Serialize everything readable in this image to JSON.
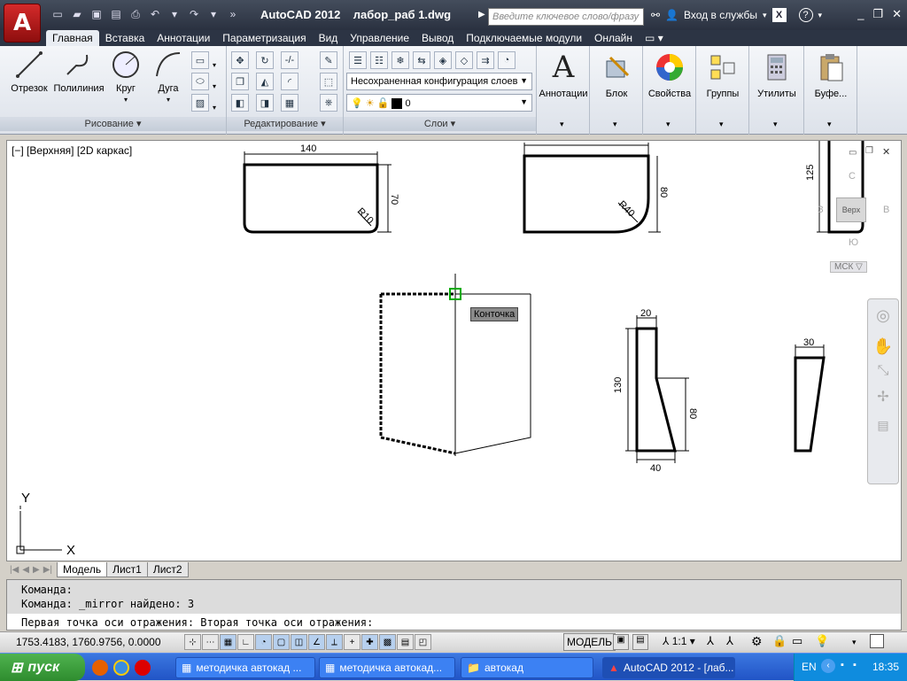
{
  "titlebar": {
    "app_name": "AutoCAD 2012",
    "file_name": "лабор_раб 1.dwg",
    "search_placeholder": "Введите ключевое слово/фразу",
    "login_label": "Вход в службы",
    "app_logo": "A"
  },
  "ribbon_tabs": [
    "Главная",
    "Вставка",
    "Аннотации",
    "Параметризация",
    "Вид",
    "Управление",
    "Вывод",
    "Подключаемые модули",
    "Онлайн"
  ],
  "ribbon": {
    "draw_tools": [
      "Отрезок",
      "Полилиния",
      "Круг",
      "Дуга"
    ],
    "draw_panel": "Рисование",
    "modify_panel": "Редактирование",
    "layer_config": "Несохраненная конфигурация слоев",
    "current_layer": "0",
    "layers_panel": "Слои",
    "right_tools": [
      "Аннотации",
      "Блок",
      "Свойства",
      "Группы",
      "Утилиты",
      "Буфе..."
    ],
    "annotation_glyph": "A"
  },
  "viewport": {
    "label": "[−] [Верхняя] [2D каркас]",
    "tooltip": "Конточка",
    "ucs_x": "X",
    "ucs_y": "Y",
    "viewcube": {
      "top": "Верх",
      "north": "С",
      "south": "Ю",
      "west": "З",
      "east": "В",
      "wcs": "МСК"
    },
    "dims": {
      "d140": "140",
      "d70": "70",
      "r10": "R10",
      "d80a": "80",
      "r40": "R40",
      "d125": "125",
      "d20": "20",
      "d130": "130",
      "d80b": "80",
      "d40": "40",
      "d30": "30"
    }
  },
  "layout_tabs": [
    "Модель",
    "Лист1",
    "Лист2"
  ],
  "command": {
    "history": [
      "Команда:",
      "Команда: _mirror найдено: 3"
    ],
    "current": "Первая точка оси отражения: Вторая точка оси отражения:"
  },
  "status": {
    "coords": "1753.4183, 1760.9756, 0.0000",
    "model": "МОДЕЛЬ",
    "scale": "1:1"
  },
  "taskbar": {
    "start": "пуск",
    "tasks": [
      "методичка автокад ...",
      "методичка автокад...",
      "автокад",
      "AutoCAD 2012 - [лаб..."
    ],
    "lang": "EN",
    "time": "18:35"
  },
  "colors": {
    "accent_red": "#c41e1e",
    "title_bg": "#2a3140",
    "taskbar": "#2154c6",
    "start": "#3a9c3a"
  }
}
